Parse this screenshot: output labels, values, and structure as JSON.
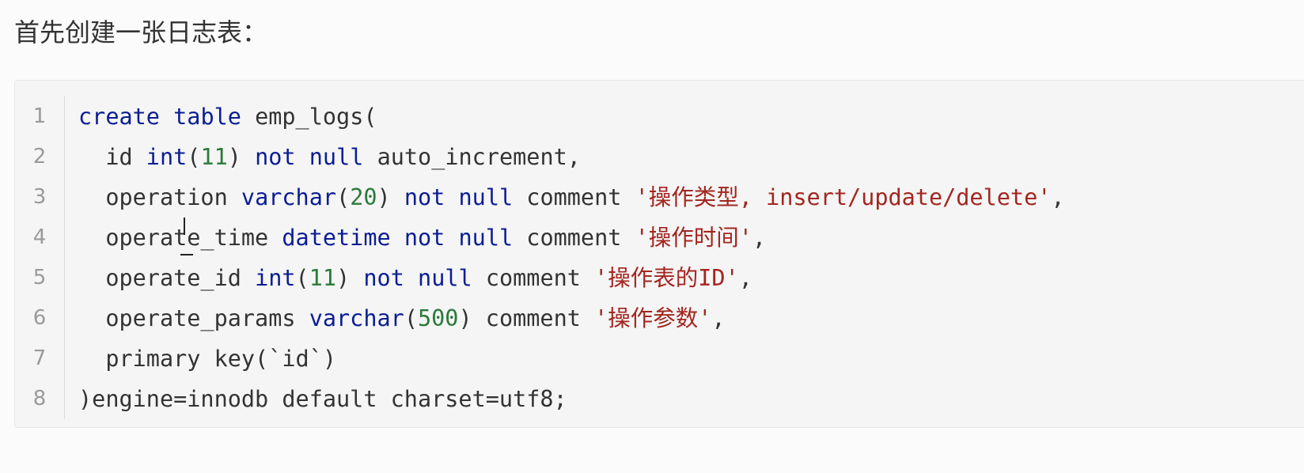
{
  "heading": "首先创建一张日志表：",
  "code": {
    "line_numbers": [
      "1",
      "2",
      "3",
      "4",
      "5",
      "6",
      "7",
      "8"
    ],
    "lines": [
      [
        {
          "t": "kw",
          "v": "create"
        },
        {
          "t": "pln",
          "v": " "
        },
        {
          "t": "kw",
          "v": "table"
        },
        {
          "t": "pln",
          "v": " emp_logs("
        }
      ],
      [
        {
          "t": "pln",
          "v": "  id "
        },
        {
          "t": "kw",
          "v": "int"
        },
        {
          "t": "pln",
          "v": "("
        },
        {
          "t": "num",
          "v": "11"
        },
        {
          "t": "pln",
          "v": ") "
        },
        {
          "t": "kw",
          "v": "not"
        },
        {
          "t": "pln",
          "v": " "
        },
        {
          "t": "kw",
          "v": "null"
        },
        {
          "t": "pln",
          "v": " auto_increment,"
        }
      ],
      [
        {
          "t": "pln",
          "v": "  operation "
        },
        {
          "t": "kw",
          "v": "varchar"
        },
        {
          "t": "pln",
          "v": "("
        },
        {
          "t": "num",
          "v": "20"
        },
        {
          "t": "pln",
          "v": ") "
        },
        {
          "t": "kw",
          "v": "not"
        },
        {
          "t": "pln",
          "v": " "
        },
        {
          "t": "kw",
          "v": "null"
        },
        {
          "t": "pln",
          "v": " comment "
        },
        {
          "t": "str",
          "v": "'操作类型, insert/update/delete'"
        },
        {
          "t": "pln",
          "v": ","
        }
      ],
      [
        {
          "t": "pln",
          "v": "  operate_time "
        },
        {
          "t": "kw",
          "v": "datetime"
        },
        {
          "t": "pln",
          "v": " "
        },
        {
          "t": "kw",
          "v": "not"
        },
        {
          "t": "pln",
          "v": " "
        },
        {
          "t": "kw",
          "v": "null"
        },
        {
          "t": "pln",
          "v": " comment "
        },
        {
          "t": "str",
          "v": "'操作时间'"
        },
        {
          "t": "pln",
          "v": ","
        }
      ],
      [
        {
          "t": "pln",
          "v": "  operate_id "
        },
        {
          "t": "kw",
          "v": "int"
        },
        {
          "t": "pln",
          "v": "("
        },
        {
          "t": "num",
          "v": "11"
        },
        {
          "t": "pln",
          "v": ") "
        },
        {
          "t": "kw",
          "v": "not"
        },
        {
          "t": "pln",
          "v": " "
        },
        {
          "t": "kw",
          "v": "null"
        },
        {
          "t": "pln",
          "v": " comment "
        },
        {
          "t": "str",
          "v": "'操作表的ID'"
        },
        {
          "t": "pln",
          "v": ","
        }
      ],
      [
        {
          "t": "pln",
          "v": "  operate_params "
        },
        {
          "t": "kw",
          "v": "varchar"
        },
        {
          "t": "pln",
          "v": "("
        },
        {
          "t": "num",
          "v": "500"
        },
        {
          "t": "pln",
          "v": ") comment "
        },
        {
          "t": "str",
          "v": "'操作参数'"
        },
        {
          "t": "pln",
          "v": ","
        }
      ],
      [
        {
          "t": "pln",
          "v": "  primary key(`id`)"
        }
      ],
      [
        {
          "t": "pln",
          "v": ")engine=innodb default charset=utf8;"
        }
      ]
    ]
  },
  "colors": {
    "keyword": "#0b1d94",
    "string": "#a3261f",
    "number": "#2a7a3a",
    "plain": "#333333"
  }
}
